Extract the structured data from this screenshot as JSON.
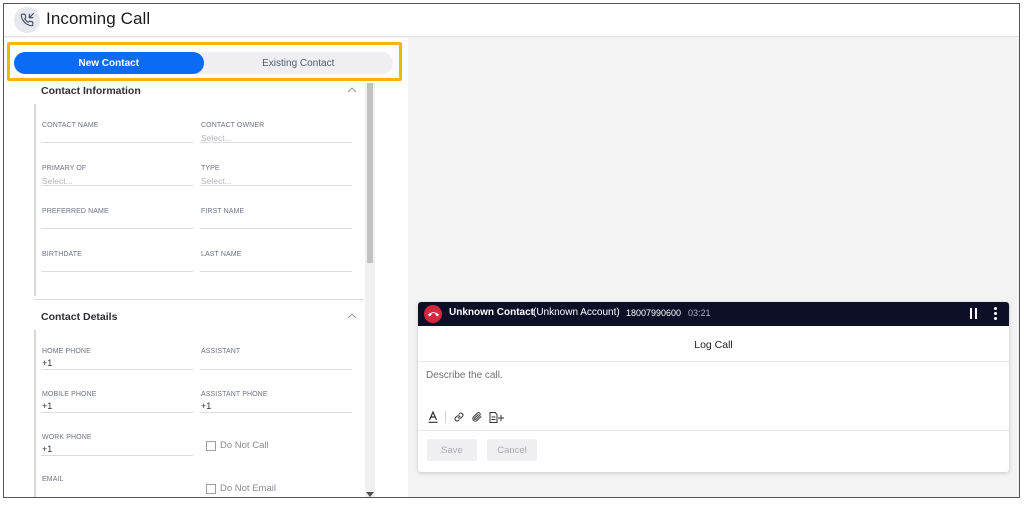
{
  "header": {
    "title": "Incoming Call",
    "icon": "phone-incoming-icon"
  },
  "tabs": {
    "new_contact": "New Contact",
    "existing_contact": "Existing Contact",
    "selected": "New Contact"
  },
  "contact_information": {
    "title": "Contact Information",
    "fields": {
      "contact_name": {
        "label": "CONTACT NAME",
        "value": ""
      },
      "contact_owner": {
        "label": "CONTACT OWNER",
        "placeholder": "Select..."
      },
      "primary_of": {
        "label": "PRIMARY OF",
        "placeholder": "Select..."
      },
      "type": {
        "label": "TYPE",
        "placeholder": "Select..."
      },
      "preferred_name": {
        "label": "PREFERRED NAME",
        "value": ""
      },
      "first_name": {
        "label": "FIRST NAME",
        "value": ""
      },
      "birthdate": {
        "label": "BIRTHDATE",
        "value": ""
      },
      "last_name": {
        "label": "LAST NAME",
        "value": ""
      }
    }
  },
  "contact_details": {
    "title": "Contact Details",
    "fields": {
      "home_phone": {
        "label": "HOME PHONE",
        "value": "+1"
      },
      "assistant": {
        "label": "ASSISTANT",
        "value": ""
      },
      "mobile_phone": {
        "label": "MOBILE PHONE",
        "value": "+1"
      },
      "assistant_phone": {
        "label": "ASSISTANT PHONE",
        "value": "+1"
      },
      "work_phone": {
        "label": "WORK PHONE",
        "value": "+1"
      },
      "email": {
        "label": "EMAIL",
        "value": ""
      }
    },
    "do_not_call": "Do Not Call",
    "do_not_email": "Do Not Email"
  },
  "call": {
    "contact_name": "Unknown Contact",
    "account": "(Unknown Account)",
    "number": "18007990600",
    "duration": "03:21",
    "log_title": "Log Call",
    "description_placeholder": "Describe the call.",
    "save_label": "Save",
    "cancel_label": "Cancel"
  },
  "colors": {
    "accent": "#0a6cf5",
    "highlight": "#f2b705",
    "call_bar": "#0d0f27",
    "hangup": "#d3283e"
  }
}
